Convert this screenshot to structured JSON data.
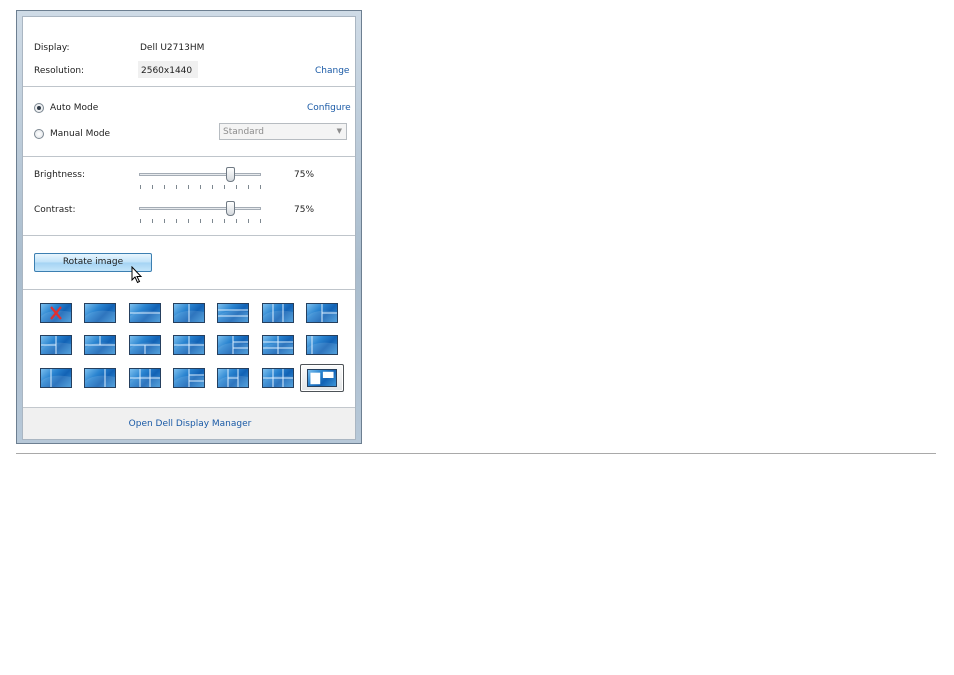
{
  "display": {
    "label": "Display:",
    "value": "Dell U2713HM"
  },
  "resolution": {
    "label": "Resolution:",
    "value": "2560x1440",
    "change_link": "Change"
  },
  "mode": {
    "auto_label": "Auto Mode",
    "auto_selected": true,
    "configure_link": "Configure",
    "manual_label": "Manual Mode",
    "manual_selected": false,
    "preset_value": "Standard"
  },
  "brightness": {
    "label": "Brightness:",
    "value_text": "75%",
    "value": 75
  },
  "contrast": {
    "label": "Contrast:",
    "value_text": "75%",
    "value": 75
  },
  "rotate_button": "Rotate image",
  "easy_arrange": {
    "layout_count": 21,
    "selected_index": 20,
    "first_layout_icon": "red-x-icon"
  },
  "footer": {
    "open_manager_link": "Open Dell Display Manager"
  },
  "colors": {
    "link": "#1a5aa6",
    "thumbnail_blue": "#1262b5",
    "button_blue": "#a4d3f3",
    "cross_red": "#e03030"
  }
}
